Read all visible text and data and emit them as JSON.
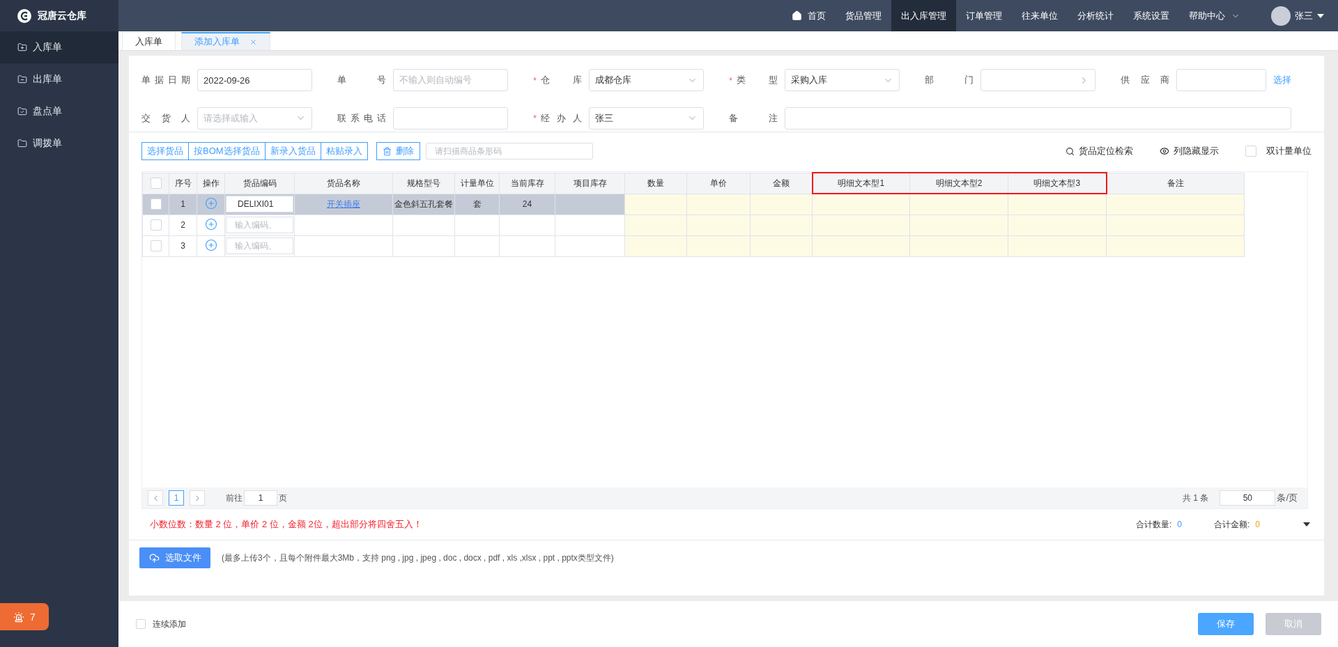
{
  "app": {
    "logo_text": "冠唐云仓库"
  },
  "nav": [
    {
      "label": "首页",
      "selected": false,
      "kind": "home"
    },
    {
      "label": "货品管理",
      "selected": false,
      "kind": "plain"
    },
    {
      "label": "出入库管理",
      "selected": true,
      "kind": "plain"
    },
    {
      "label": "订单管理",
      "selected": false,
      "kind": "plain"
    },
    {
      "label": "往来单位",
      "selected": false,
      "kind": "plain"
    },
    {
      "label": "分析统计",
      "selected": false,
      "kind": "plain"
    },
    {
      "label": "系统设置",
      "selected": false,
      "kind": "plain"
    },
    {
      "label": "帮助中心",
      "selected": false,
      "kind": "menu"
    }
  ],
  "user": {
    "name": "张三"
  },
  "sidebar": {
    "items": [
      {
        "label": "入库单",
        "selected": true
      },
      {
        "label": "出库单",
        "selected": false
      },
      {
        "label": "盘点单",
        "selected": false
      },
      {
        "label": "调拨单",
        "selected": false
      }
    ],
    "alert_badge": {
      "count": "7"
    }
  },
  "tabs": [
    {
      "label": "入库单",
      "selected": false,
      "closable": false
    },
    {
      "label": "添加入库单",
      "selected": true,
      "closable": true
    }
  ],
  "form": {
    "required_mark": "*",
    "rows": [
      [
        {
          "label": "单据日期",
          "kind": "text",
          "value": "2022-09-26",
          "required": false
        },
        {
          "label": "单号",
          "kind": "text",
          "placeholder": "不输入则自动编号",
          "required": false
        },
        {
          "label": "仓库",
          "kind": "select",
          "value": "成都仓库",
          "required": true
        },
        {
          "label": "类型",
          "kind": "select",
          "value": "采购入库",
          "required": true
        },
        {
          "label": "部门",
          "kind": "cascade",
          "required": false
        },
        {
          "label": "供应商",
          "kind": "text",
          "required": false,
          "link": "选择"
        }
      ],
      [
        {
          "label": "交货人",
          "kind": "select",
          "placeholder": "请选择或输入",
          "required": false
        },
        {
          "label": "联系电话",
          "kind": "text",
          "required": false
        },
        {
          "label": "经办人",
          "kind": "select",
          "value": "张三",
          "required": true
        },
        {
          "label": "备注",
          "kind": "wide",
          "required": false
        }
      ]
    ]
  },
  "toolbar": {
    "group_buttons": [
      "选择货品",
      "按BOM选择货品",
      "新录入货品",
      "粘贴录入"
    ],
    "delete_button": "删除",
    "scan_placeholder": "请扫描商品条形码",
    "locate": "货品定位检索",
    "columns_toggle": "列隐藏显示",
    "dual_unit": {
      "label": "双计量单位",
      "checked": false
    }
  },
  "table": {
    "header_checked": false,
    "columns": [
      {
        "kind": "check",
        "highlighted": false
      },
      {
        "label": "序号",
        "kind": "seq",
        "highlighted": false
      },
      {
        "label": "操作",
        "kind": "action",
        "highlighted": false
      },
      {
        "label": "货品编码",
        "kind": "code",
        "highlighted": false
      },
      {
        "label": "货品名称",
        "kind": "name",
        "highlighted": false
      },
      {
        "label": "规格型号",
        "kind": "spec",
        "highlighted": false
      },
      {
        "label": "计量单位",
        "kind": "unit",
        "highlighted": false
      },
      {
        "label": "当前库存",
        "kind": "stock",
        "highlighted": false
      },
      {
        "label": "项目库存",
        "kind": "plain",
        "highlighted": false
      },
      {
        "label": "数量",
        "kind": "entry",
        "highlighted": false
      },
      {
        "label": "单价",
        "kind": "entry",
        "highlighted": false
      },
      {
        "label": "金额",
        "kind": "entry",
        "highlighted": false
      },
      {
        "label": "明细文本型1",
        "kind": "entry",
        "highlighted": true
      },
      {
        "label": "明细文本型2",
        "kind": "entry",
        "highlighted": true
      },
      {
        "label": "明细文本型3",
        "kind": "entry",
        "highlighted": true
      },
      {
        "label": "备注",
        "kind": "entry",
        "highlighted": false
      }
    ],
    "rows": [
      {
        "selected": true,
        "checked": false,
        "seq": "1",
        "code": "DELIXI01",
        "name": "开关插座",
        "spec": "金色斜五孔套餐",
        "unit": "套",
        "stock": "24"
      },
      {
        "selected": false,
        "checked": false,
        "seq": "2",
        "code_placeholder": "输入编码、"
      },
      {
        "selected": false,
        "checked": false,
        "seq": "3",
        "code_placeholder": "输入编码、"
      }
    ]
  },
  "pagination": {
    "pages": [
      {
        "label": "1",
        "selected": true
      }
    ],
    "goto_label": "前往",
    "goto_value": "1",
    "goto_suffix": "页",
    "total": "共 1 条",
    "page_size": "50",
    "page_size_suffix": "条/页"
  },
  "summary": {
    "notice": "小数位数：数量 2 位，单价 2 位，金额 2位，超出部分将四舍五入！",
    "qty_label": "合计数量:",
    "qty_value": "0",
    "amount_label": "合计金额:",
    "amount_value": "0"
  },
  "upload": {
    "button": "选取文件",
    "hint": "(最多上传3个，且每个附件最大3Mb，支持 png , jpg , jpeg , doc , docx , pdf , xls ,xlsx , ppt , pptx类型文件)"
  },
  "footer": {
    "continue": {
      "label": "连续添加",
      "checked": false
    },
    "buttons": [
      {
        "label": "保存",
        "kind": "primary"
      },
      {
        "label": "取消",
        "kind": "disabled"
      }
    ]
  }
}
